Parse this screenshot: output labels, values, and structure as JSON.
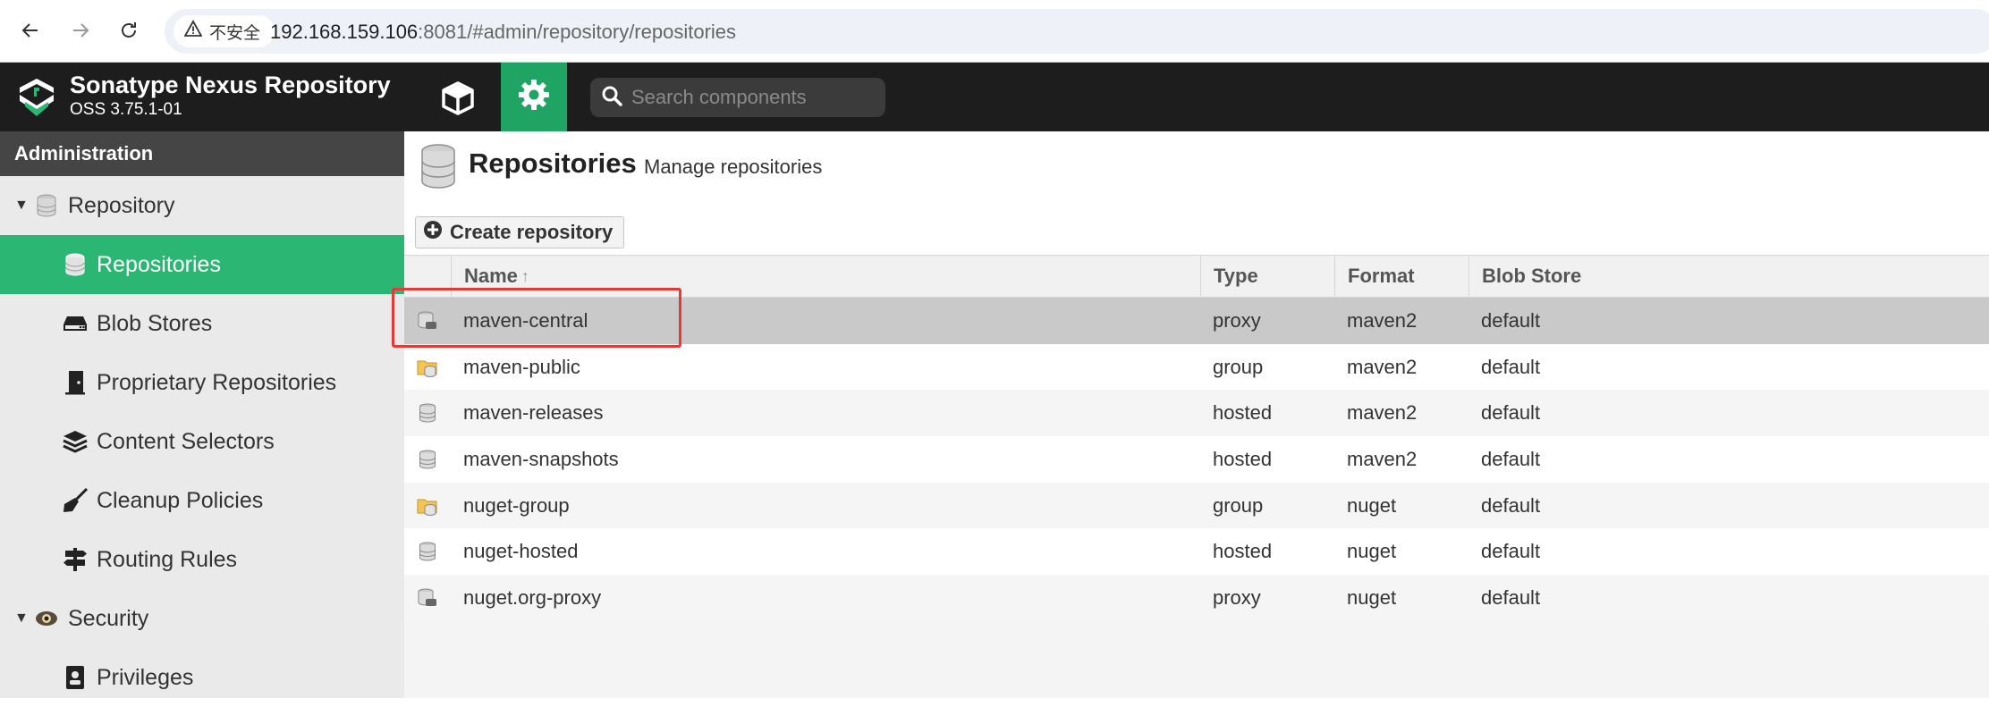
{
  "browser": {
    "security_label": "不安全",
    "url_host": "192.168.159.106",
    "url_rest": ":8081/#admin/repository/repositories"
  },
  "header": {
    "title": "Sonatype Nexus Repository",
    "version": "OSS 3.75.1-01",
    "search_placeholder": "Search components",
    "accent_color": "#1fa463"
  },
  "sidebar": {
    "title": "Administration",
    "items": [
      {
        "label": "Repository",
        "kind": "group",
        "icon": "database-icon"
      },
      {
        "label": "Repositories",
        "kind": "child",
        "icon": "database-icon",
        "active": true
      },
      {
        "label": "Blob Stores",
        "kind": "child",
        "icon": "hdd-icon"
      },
      {
        "label": "Proprietary Repositories",
        "kind": "child",
        "icon": "door-icon"
      },
      {
        "label": "Content Selectors",
        "kind": "child",
        "icon": "layers-icon"
      },
      {
        "label": "Cleanup Policies",
        "kind": "child",
        "icon": "broom-icon"
      },
      {
        "label": "Routing Rules",
        "kind": "child",
        "icon": "signpost-icon"
      },
      {
        "label": "Security",
        "kind": "group",
        "icon": "eye-icon"
      },
      {
        "label": "Privileges",
        "kind": "child",
        "icon": "id-badge-icon"
      }
    ]
  },
  "page": {
    "title": "Repositories",
    "subtitle": "Manage repositories",
    "create_button": "Create repository"
  },
  "table": {
    "columns": {
      "name": "Name",
      "type": "Type",
      "format": "Format",
      "blob": "Blob Store"
    },
    "sort_indicator": "↑",
    "rows": [
      {
        "name": "maven-central",
        "type": "proxy",
        "format": "maven2",
        "blob": "default",
        "icon": "proxy-repo-icon",
        "selected": true
      },
      {
        "name": "maven-public",
        "type": "group",
        "format": "maven2",
        "blob": "default",
        "icon": "group-repo-icon"
      },
      {
        "name": "maven-releases",
        "type": "hosted",
        "format": "maven2",
        "blob": "default",
        "icon": "hosted-repo-icon"
      },
      {
        "name": "maven-snapshots",
        "type": "hosted",
        "format": "maven2",
        "blob": "default",
        "icon": "hosted-repo-icon"
      },
      {
        "name": "nuget-group",
        "type": "group",
        "format": "nuget",
        "blob": "default",
        "icon": "group-repo-icon"
      },
      {
        "name": "nuget-hosted",
        "type": "hosted",
        "format": "nuget",
        "blob": "default",
        "icon": "hosted-repo-icon"
      },
      {
        "name": "nuget.org-proxy",
        "type": "proxy",
        "format": "nuget",
        "blob": "default",
        "icon": "proxy-repo-icon"
      }
    ]
  }
}
